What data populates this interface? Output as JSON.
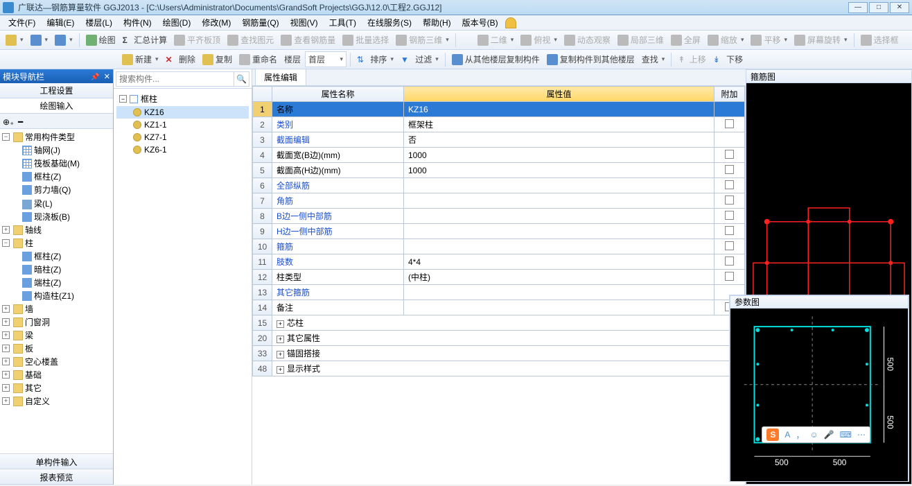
{
  "title": "广联达—钢筋算量软件 GGJ2013 - [C:\\Users\\Administrator\\Documents\\GrandSoft Projects\\GGJ\\12.0\\工程2.GGJ12]",
  "menu": [
    "文件(F)",
    "编辑(E)",
    "楼层(L)",
    "构件(N)",
    "绘图(D)",
    "修改(M)",
    "钢筋量(Q)",
    "视图(V)",
    "工具(T)",
    "在线服务(S)",
    "帮助(H)",
    "版本号(B)"
  ],
  "tb1": {
    "draw": "绘图",
    "sum": "汇总计算",
    "flat": "平齐板顶",
    "viewg": "查找图元",
    "viewr": "查看钢筋量",
    "batch": "批量选择",
    "rebar3d": "钢筋三维",
    "twod": "二维",
    "peek": "俯视",
    "dyn": "动态观察",
    "local3d": "局部三维",
    "full": "全屏",
    "zoom": "缩放",
    "pan": "平移",
    "rot": "屏幕旋转",
    "selr": "选择框"
  },
  "tb2": {
    "new": "新建",
    "del": "删除",
    "copy": "复制",
    "rename": "重命名",
    "floor": "楼层",
    "floorval": "首层",
    "sort": "排序",
    "filter": "过滤",
    "cpfrom": "从其他楼层复制构件",
    "cpto": "复制构件到其他楼层",
    "find": "查找",
    "up": "上移",
    "down": "下移"
  },
  "nav": {
    "title": "模块导航栏",
    "secs": [
      "工程设置",
      "绘图输入"
    ],
    "foot": [
      "单构件输入",
      "报表预览"
    ],
    "tree": [
      {
        "label": "常用构件类型",
        "open": true,
        "children": [
          {
            "label": "轴网(J)",
            "icon": "grid"
          },
          {
            "label": "筏板基础(M)",
            "icon": "grid"
          },
          {
            "label": "框柱(Z)",
            "icon": "col"
          },
          {
            "label": "剪力墙(Q)",
            "icon": "col"
          },
          {
            "label": "梁(L)",
            "icon": "beam"
          },
          {
            "label": "现浇板(B)",
            "icon": "col"
          }
        ]
      },
      {
        "label": "轴线",
        "open": false
      },
      {
        "label": "柱",
        "open": true,
        "children": [
          {
            "label": "框柱(Z)",
            "icon": "col"
          },
          {
            "label": "暗柱(Z)",
            "icon": "col"
          },
          {
            "label": "端柱(Z)",
            "icon": "col"
          },
          {
            "label": "构造柱(Z1)",
            "icon": "col"
          }
        ]
      },
      {
        "label": "墙",
        "open": false
      },
      {
        "label": "门窗洞",
        "open": false
      },
      {
        "label": "梁",
        "open": false
      },
      {
        "label": "板",
        "open": false
      },
      {
        "label": "空心楼盖",
        "open": false
      },
      {
        "label": "基础",
        "open": false
      },
      {
        "label": "其它",
        "open": false
      },
      {
        "label": "自定义",
        "open": false
      }
    ]
  },
  "search_ph": "搜索构件...",
  "components": {
    "root": "框柱",
    "items": [
      "KZ16",
      "KZ1-1",
      "KZ7-1",
      "KZ6-1"
    ],
    "selected": "KZ16"
  },
  "prop": {
    "tab": "属性编辑",
    "hdr": {
      "rn": "",
      "name": "属性名称",
      "val": "属性值",
      "add": "附加"
    },
    "rows": [
      {
        "n": 1,
        "name": "名称",
        "val": "KZ16",
        "sel": true,
        "link": false,
        "ck": false
      },
      {
        "n": 2,
        "name": "类别",
        "val": "框架柱",
        "link": true,
        "ck": true
      },
      {
        "n": 3,
        "name": "截面编辑",
        "val": "否",
        "link": true,
        "ck": false
      },
      {
        "n": 4,
        "name": "截面宽(B边)(mm)",
        "val": "1000",
        "link": false,
        "ck": true
      },
      {
        "n": 5,
        "name": "截面高(H边)(mm)",
        "val": "1000",
        "link": false,
        "ck": true
      },
      {
        "n": 6,
        "name": "全部纵筋",
        "val": "",
        "link": true,
        "ck": true
      },
      {
        "n": 7,
        "name": "角筋",
        "val": "",
        "link": true,
        "ck": true
      },
      {
        "n": 8,
        "name": "B边一侧中部筋",
        "val": "",
        "link": true,
        "ck": true
      },
      {
        "n": 9,
        "name": "H边一侧中部筋",
        "val": "",
        "link": true,
        "ck": true
      },
      {
        "n": 10,
        "name": "箍筋",
        "val": "",
        "link": true,
        "ck": true
      },
      {
        "n": 11,
        "name": "肢数",
        "val": "4*4",
        "link": true,
        "ck": true
      },
      {
        "n": 12,
        "name": "柱类型",
        "val": "(中柱)",
        "link": false,
        "ck": true
      },
      {
        "n": 13,
        "name": "其它箍筋",
        "val": "",
        "link": true,
        "ck": false
      },
      {
        "n": 14,
        "name": "备注",
        "val": "",
        "link": false,
        "ck": true
      }
    ],
    "exp": [
      {
        "n": 15,
        "name": "芯柱"
      },
      {
        "n": 20,
        "name": "其它属性"
      },
      {
        "n": 33,
        "name": "锚固搭接"
      },
      {
        "n": 48,
        "name": "显示样式"
      }
    ]
  },
  "panels": {
    "stir": "箍筋图",
    "param": "参数图",
    "dim": "500"
  },
  "ime": [
    "A",
    "，",
    "☺",
    "🎤",
    "⌨",
    "⋯"
  ]
}
